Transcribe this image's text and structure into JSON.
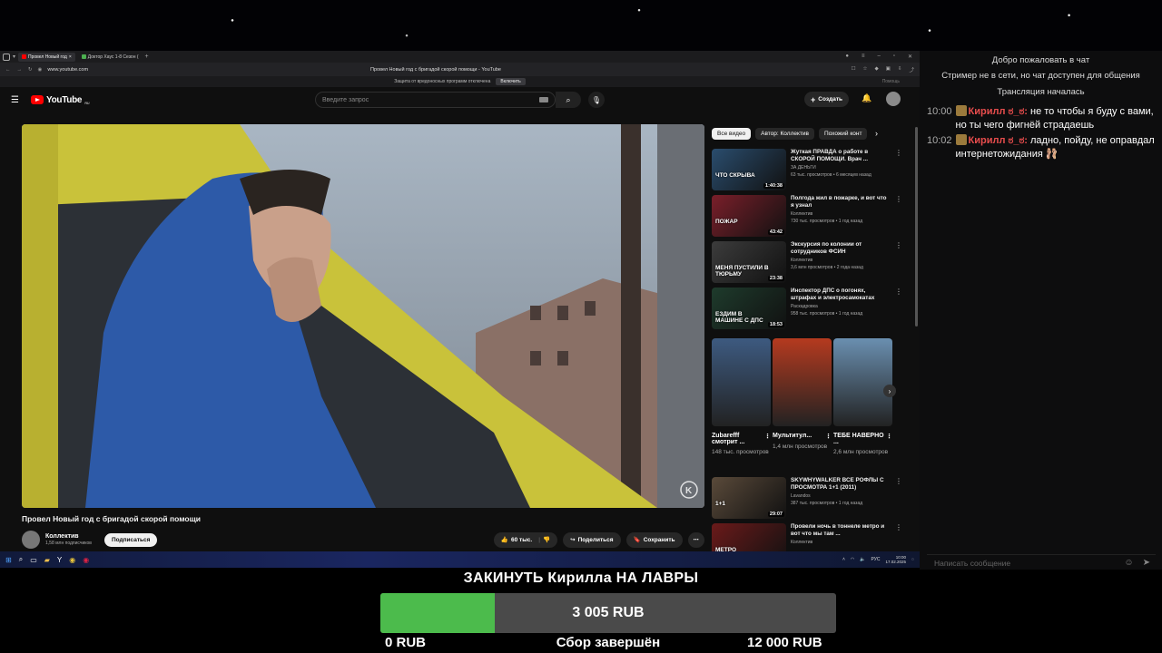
{
  "browser": {
    "tabs": [
      {
        "label": "Провел Новый год",
        "active": true,
        "color": "#ff0000"
      },
      {
        "label": "Доктор Хаус 1-8 Сезон (",
        "active": false,
        "color": "#4caf50"
      }
    ],
    "url": "www.youtube.com",
    "page_title": "Провел Новый год с бригадой скорой помощи - YouTube",
    "protection_text": "Защита от вредоносных программ отключена",
    "protection_button": "Включить",
    "help_text": "Помощь"
  },
  "youtube": {
    "logo": "YouTube",
    "region": "RU",
    "search_placeholder": "Введите запрос",
    "create_label": "Создать",
    "video_title": "Провел Новый год с бригадой скорой помощи",
    "channel_name": "Коллектив",
    "channel_subs": "1,58 млн подписчиков",
    "subscribe_label": "Подписаться",
    "likes": "60 тыс.",
    "share_label": "Поделиться",
    "save_label": "Сохранить",
    "watermark": "K",
    "chips": [
      "Все видео",
      "Автор: Коллектив",
      "Похожий конт"
    ],
    "recommendations": [
      {
        "title": "Жуткая ПРАВДА о работе в СКОРОЙ ПОМОЩИ. Врач ...",
        "channel": "ЗА ДЕНЬГИ",
        "meta": "63 тыс. просмотров • 6 месяцев назад",
        "duration": "1:40:38",
        "thumb": "ЧТО СКРЫВА",
        "color": "#2a4d6e"
      },
      {
        "title": "Полгода жил в пожарке, и вот что я узнал",
        "channel": "Коллектив",
        "meta": "730 тыс. просмотров • 1 год назад",
        "duration": "43:42",
        "thumb": "ПОЖАР",
        "color": "#7a1f2a"
      },
      {
        "title": "Экскурсия по колонии от сотрудников ФСИН",
        "channel": "Коллектив",
        "meta": "3,6 млн просмотров • 2 года назад",
        "duration": "23:38",
        "thumb": "МЕНЯ ПУСТИЛИ В ТЮРЬМУ",
        "color": "#3c3c3c"
      },
      {
        "title": "Инспектор ДПС о погонях, штрафах и электросамокатах",
        "channel": "Раскадровка",
        "meta": "958 тыс. просмотров • 1 год назад",
        "duration": "18:53",
        "thumb": "ЕЗДИМ В МАШИНЕ С ДПС",
        "color": "#1e3b2c"
      },
      {
        "title": "SKYWHYWALKER ВСЕ РОФЛЫ С ПРОСМОТРА 1+1 (2011)",
        "channel": "Lavandos",
        "meta": "387 тыс. просмотров • 1 год назад",
        "duration": "29:07",
        "thumb": "1+1",
        "color": "#5a4a3a"
      },
      {
        "title": "Провели ночь в тоннеле метро и вот что мы там ...",
        "channel": "Коллектив",
        "meta": "",
        "duration": "",
        "thumb": "МЕТРО",
        "color": "#6b1a1a"
      }
    ],
    "shorts": [
      {
        "title": "Zubarefff смотрит ...",
        "views": "148 тыс. просмотров",
        "color": "#3d5a80"
      },
      {
        "title": "Мультитул...",
        "views": "1,4 млн просмотров",
        "color": "#b53a1f"
      },
      {
        "title": "ТЕБЕ НАВЕРНО ...",
        "views": "2,6 млн просмотров",
        "color": "#6a8fb0"
      }
    ]
  },
  "taskbar": {
    "lang": "РУС",
    "time": "10:00",
    "date": "17.02.2025"
  },
  "chat": {
    "system": [
      "Добро пожаловать в чат",
      "Стример не в сети, но чат доступен для общения",
      "Трансляция началась"
    ],
    "messages": [
      {
        "time": "10:00",
        "author": "Кирилл ಠ_ಠ:",
        "text": "не то чтобы я буду с вами, но ты чего фигнёй страдаешь"
      },
      {
        "time": "10:02",
        "author": "Кирилл ಠ_ಠ:",
        "text": "ладно, пойду, не оправдал интернетожидания"
      }
    ],
    "input_placeholder": "Написать сообщение"
  },
  "goal": {
    "title": "ЗАКИНУТЬ Кирилла НА ЛАВРЫ",
    "current": "3 005 RUB",
    "min": "0 RUB",
    "max": "12 000 RUB",
    "status": "Сбор завершён",
    "progress": 0.25,
    "fill_color": "#4cbb4c"
  }
}
